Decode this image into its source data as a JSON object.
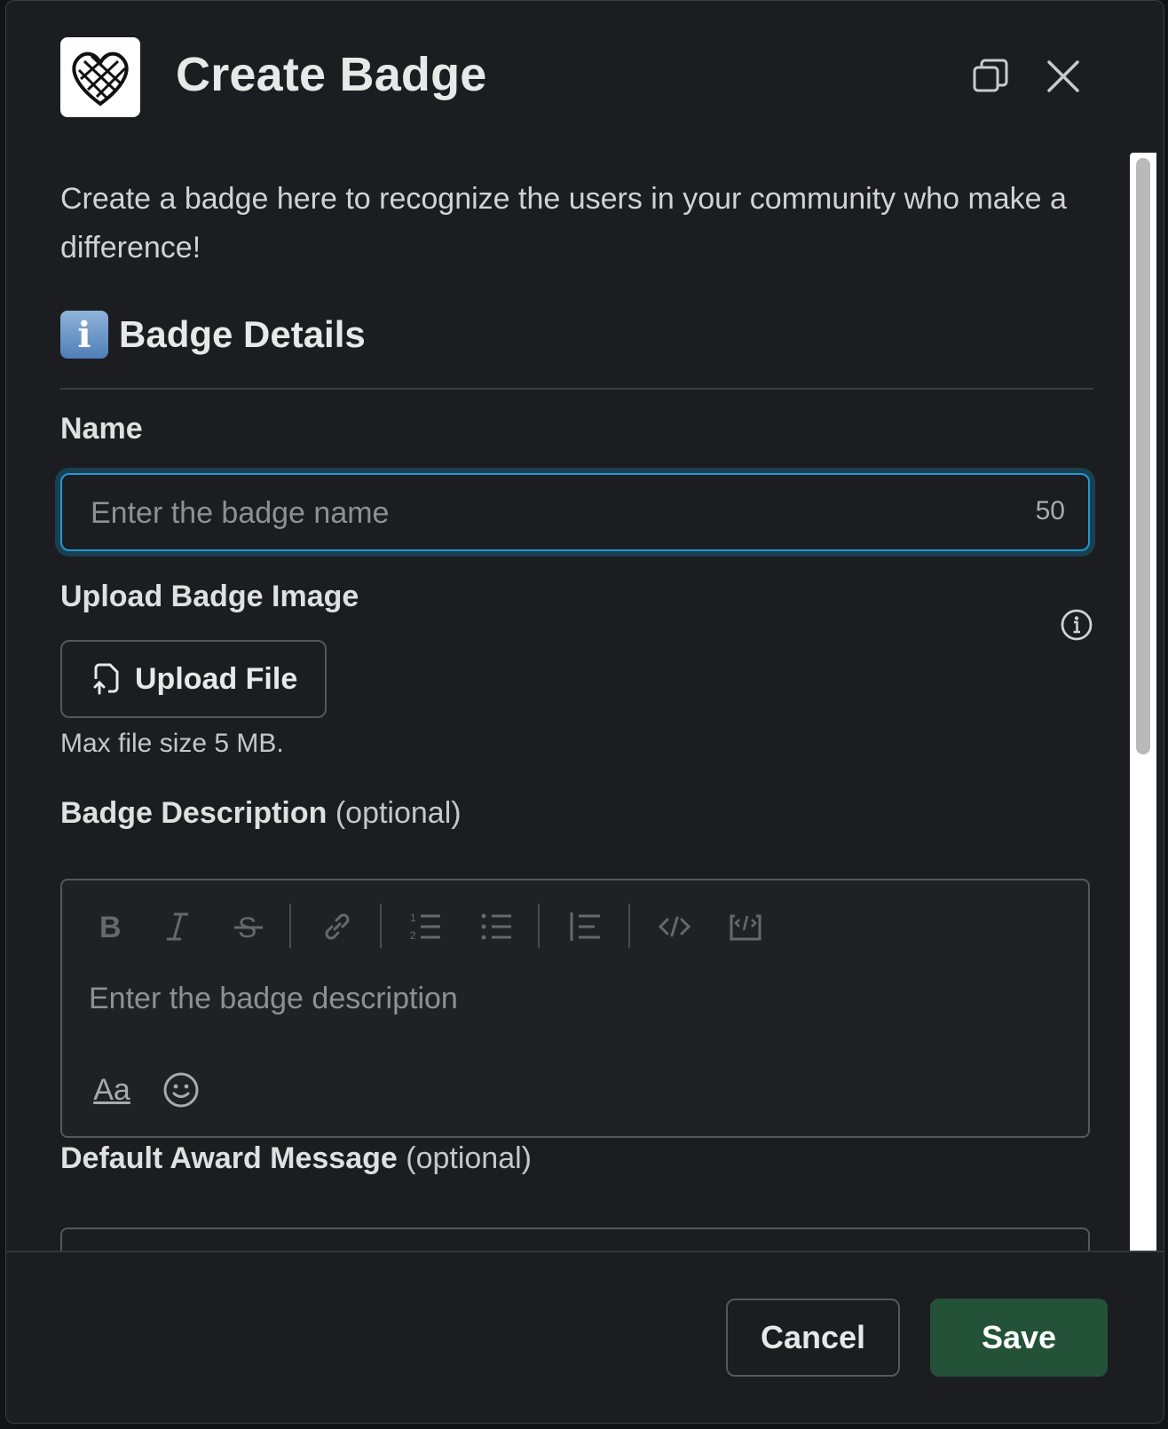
{
  "modal": {
    "title": "Create Badge",
    "intro": "Create a badge here to recognize the users in your community who make a difference!"
  },
  "section": {
    "icon": "info-emoji",
    "title": "Badge Details"
  },
  "name_field": {
    "label": "Name",
    "placeholder": "Enter the badge name",
    "char_limit": "50"
  },
  "upload": {
    "label": "Upload Badge Image",
    "button_label": "Upload File",
    "hint": "Max file size 5 MB."
  },
  "description": {
    "label": "Badge Description",
    "optional": "(optional)",
    "placeholder": "Enter the badge description",
    "toolbar": [
      "bold",
      "italic",
      "strikethrough",
      "link",
      "ordered-list",
      "bulleted-list",
      "blockquote",
      "code",
      "code-block"
    ],
    "format_label": "Aa"
  },
  "award_message": {
    "label": "Default Award Message",
    "optional": "(optional)"
  },
  "footer": {
    "cancel_label": "Cancel",
    "save_label": "Save"
  },
  "colors": {
    "accent_focus": "#1d9bd1",
    "save_button": "#235238",
    "background": "#1b1d21"
  }
}
